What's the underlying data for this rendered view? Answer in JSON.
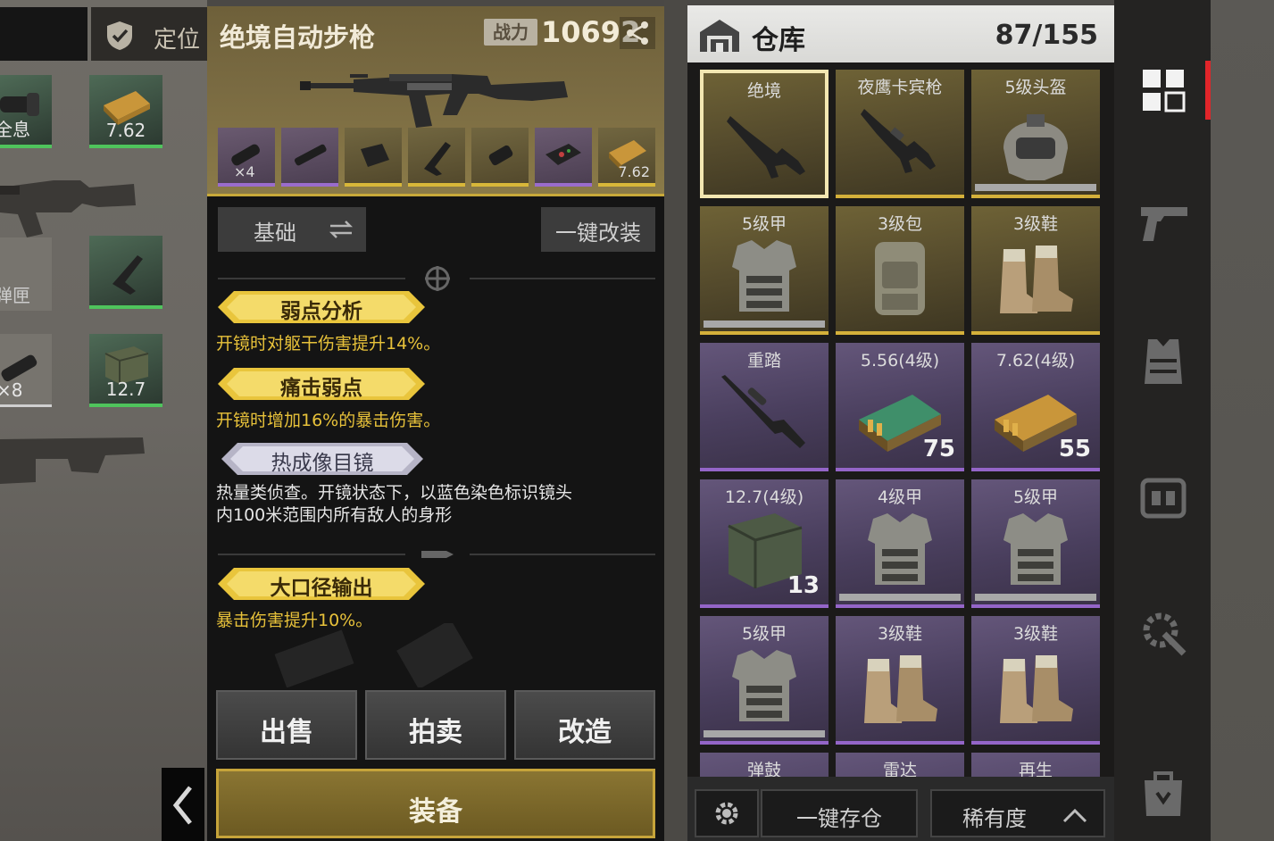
{
  "left_panel": {
    "location_label": "定位",
    "slots": [
      {
        "label": "全息",
        "rarity": "green"
      },
      {
        "label": "7.62",
        "rarity": "green"
      },
      {
        "label": "弹匣",
        "rarity": "grey"
      },
      {
        "label": "",
        "rarity": "green"
      },
      {
        "label": "×8",
        "rarity": "grey"
      },
      {
        "label": "12.7",
        "rarity": "green"
      }
    ]
  },
  "weapon": {
    "name": "绝境自动步枪",
    "power_label": "战力",
    "power_value": "10692",
    "attachments": [
      {
        "label": "×4",
        "rarity": "purple",
        "icon": "scope-icon"
      },
      {
        "label": "",
        "rarity": "purple",
        "icon": "muzzle-icon"
      },
      {
        "label": "",
        "rarity": "gold",
        "icon": "magazine-icon"
      },
      {
        "label": "",
        "rarity": "gold",
        "icon": "stock-icon"
      },
      {
        "label": "",
        "rarity": "gold",
        "icon": "grip-icon"
      },
      {
        "label": "",
        "rarity": "purple",
        "icon": "thermal-module-icon"
      },
      {
        "label": "7.62",
        "rarity": "gold",
        "icon": "ammo-box-icon"
      }
    ],
    "tab_label": "基础",
    "quick_mod_label": "一键改装",
    "traits": [
      {
        "name": "弱点分析",
        "style": "gold",
        "desc": "开镜时对躯干伤害提升14%。"
      },
      {
        "name": "痛击弱点",
        "style": "gold",
        "desc": "开镜时增加16%的暴击伤害。"
      },
      {
        "name": "热成像目镜",
        "style": "silver",
        "desc_lines": [
          "热量类侦查。开镜状态下，以蓝色染色标识镜头",
          "内100米范围内所有敌人的身形"
        ]
      },
      {
        "name": "大口径输出",
        "style": "gold",
        "desc": "暴击伤害提升10%。"
      }
    ],
    "actions": {
      "sell": "出售",
      "auction": "拍卖",
      "modify": "改造",
      "equip": "装备"
    }
  },
  "warehouse": {
    "title": "仓库",
    "count": "87/155",
    "items": [
      {
        "name": "绝境",
        "rarity": "gold",
        "icon": "rifle-icon",
        "qty": "",
        "durability": false,
        "selected": true
      },
      {
        "name": "夜鹰卡宾枪",
        "rarity": "gold",
        "icon": "carbine-icon",
        "qty": "",
        "durability": false
      },
      {
        "name": "5级头盔",
        "rarity": "gold",
        "icon": "helmet-icon",
        "qty": "",
        "durability": true
      },
      {
        "name": "5级甲",
        "rarity": "gold",
        "icon": "armor-icon",
        "qty": "",
        "durability": true
      },
      {
        "name": "3级包",
        "rarity": "gold",
        "icon": "backpack-icon",
        "qty": "",
        "durability": false
      },
      {
        "name": "3级鞋",
        "rarity": "gold",
        "icon": "boots-icon",
        "qty": "",
        "durability": false
      },
      {
        "name": "重踏",
        "rarity": "purple",
        "icon": "sniper-rifle-icon",
        "qty": "",
        "durability": false
      },
      {
        "name": "5.56(4级)",
        "rarity": "purple",
        "icon": "ammo-box-icon",
        "qty": "75",
        "durability": false,
        "accent": "#3f8f6a"
      },
      {
        "name": "7.62(4级)",
        "rarity": "purple",
        "icon": "ammo-box-icon",
        "qty": "55",
        "durability": false,
        "accent": "#c9963a"
      },
      {
        "name": "12.7(4级)",
        "rarity": "purple",
        "icon": "ammo-crate-icon",
        "qty": "13",
        "durability": false
      },
      {
        "name": "4级甲",
        "rarity": "purple",
        "icon": "armor-icon",
        "qty": "",
        "durability": true
      },
      {
        "name": "5级甲",
        "rarity": "purple",
        "icon": "armor-icon",
        "qty": "",
        "durability": true
      },
      {
        "name": "5级甲",
        "rarity": "purple",
        "icon": "armor-icon",
        "qty": "",
        "durability": true
      },
      {
        "name": "3级鞋",
        "rarity": "purple",
        "icon": "boots-icon",
        "qty": "",
        "durability": false
      },
      {
        "name": "3级鞋",
        "rarity": "purple",
        "icon": "boots-icon",
        "qty": "",
        "durability": false
      },
      {
        "name": "弹鼓",
        "rarity": "purple",
        "icon": "drum-mag-icon",
        "qty": "",
        "durability": false
      },
      {
        "name": "雷达",
        "rarity": "purple",
        "icon": "radar-icon",
        "qty": "",
        "durability": false
      },
      {
        "name": "再生",
        "rarity": "purple",
        "icon": "regen-icon",
        "qty": "",
        "durability": false
      }
    ],
    "store_all_label": "一键存仓",
    "sort_label": "稀有度"
  },
  "sidebar": {
    "tabs": [
      {
        "icon": "grid-icon",
        "active": true
      },
      {
        "icon": "pistol-icon",
        "active": false
      },
      {
        "icon": "vest-icon",
        "active": false
      },
      {
        "icon": "backpack-icon",
        "active": false
      },
      {
        "icon": "wrench-gear-icon",
        "active": false
      },
      {
        "icon": "shop-bag-icon",
        "active": false
      }
    ]
  },
  "colors": {
    "gold_rarity": "#d4b03a",
    "purple_rarity": "#9465c8",
    "green_rarity": "#4fc45c",
    "trait_text": "#e8c23a",
    "accent_red": "#e1252a"
  }
}
